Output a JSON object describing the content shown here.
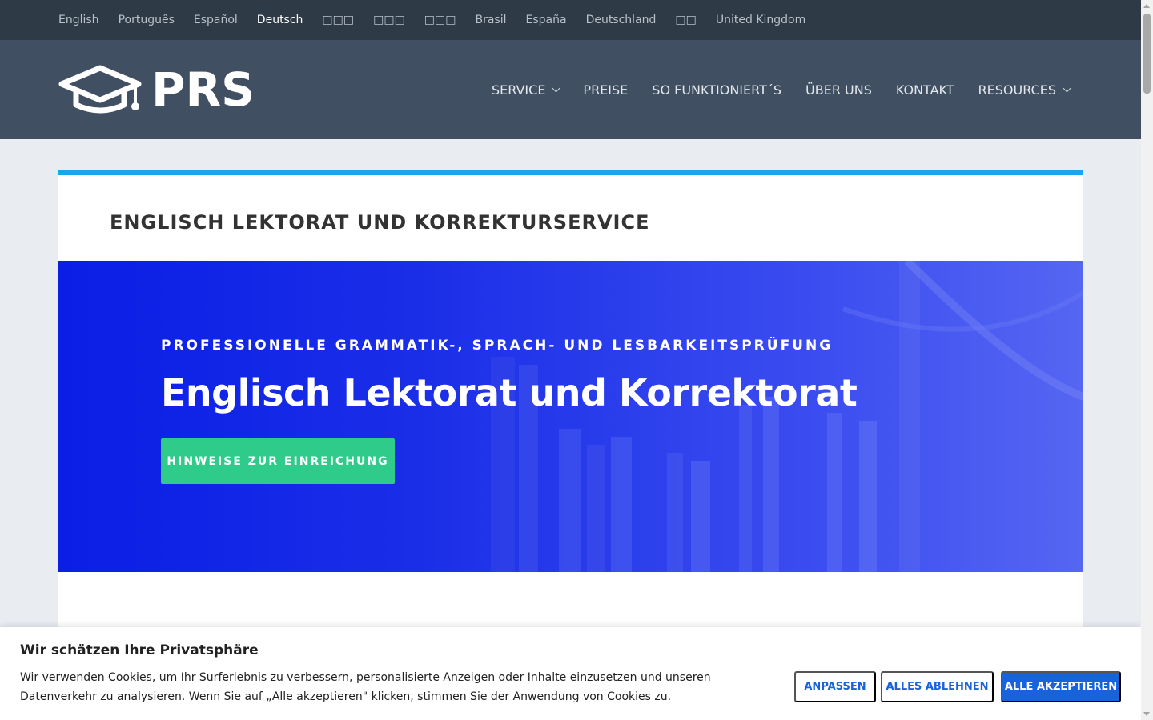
{
  "languages": [
    {
      "label": "English",
      "active": false
    },
    {
      "label": "Português",
      "active": false
    },
    {
      "label": "Español",
      "active": false
    },
    {
      "label": "Deutsch",
      "active": true
    },
    {
      "label": "□□□",
      "active": false
    },
    {
      "label": "□□□",
      "active": false
    },
    {
      "label": "□□□",
      "active": false
    },
    {
      "label": "Brasil",
      "active": false
    },
    {
      "label": "España",
      "active": false
    },
    {
      "label": "Deutschland",
      "active": false
    },
    {
      "label": "□□",
      "active": false
    },
    {
      "label": "United Kingdom",
      "active": false
    }
  ],
  "header": {
    "logo_text": "PRS",
    "logo_icon": "graduation-cap-icon",
    "nav": [
      {
        "label": "SERVICE",
        "dropdown": true
      },
      {
        "label": "PREISE",
        "dropdown": false
      },
      {
        "label": "SO FUNKTIONIERT´S",
        "dropdown": false
      },
      {
        "label": "ÜBER UNS",
        "dropdown": false
      },
      {
        "label": "KONTAKT",
        "dropdown": false
      },
      {
        "label": "RESOURCES",
        "dropdown": true
      }
    ]
  },
  "page": {
    "title": "ENGLISCH LEKTORAT UND KORREKTURSERVICE"
  },
  "hero": {
    "subtitle": "PROFESSIONELLE GRAMMATIK-, SPRACH- UND LESBARKEITSPRÜFUNG",
    "title": "Englisch Lektorat und Korrektorat",
    "button": "HINWEISE ZUR EINREICHUNG"
  },
  "cookie": {
    "title": "Wir schätzen Ihre Privatsphäre",
    "text": "Wir verwenden Cookies, um Ihr Surferlebnis zu verbessern, personalisierte Anzeigen oder Inhalte einzusetzen und unseren Datenverkehr zu analysieren. Wenn Sie auf „Alle akzeptieren\" klicken, stimmen Sie der Anwendung von Cookies zu.",
    "customize": "ANPASSEN",
    "reject": "ALLES ABLEHNEN",
    "accept": "ALLE AKZEPTIEREN"
  },
  "colors": {
    "langbar_bg": "#2e3a45",
    "header_bg": "#404f61",
    "card_accent": "#1aa6ee",
    "hero_bg": "#0a1ee6",
    "hero_button": "#2ecb8a",
    "cookie_accent": "#1863dc"
  }
}
